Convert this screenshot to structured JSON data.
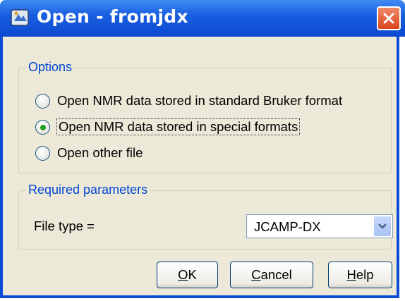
{
  "window": {
    "title": "Open - fromjdx",
    "close_icon": "close-icon",
    "app_icon": "application-icon"
  },
  "options": {
    "legend": "Options",
    "items": [
      {
        "label": "Open NMR data stored in standard Bruker format",
        "checked": false
      },
      {
        "label": "Open NMR data stored in special formats",
        "checked": true
      },
      {
        "label": "Open other file",
        "checked": false
      }
    ]
  },
  "params": {
    "legend": "Required parameters",
    "file_type_label": "File type =",
    "file_type_value": "JCAMP-DX"
  },
  "buttons": {
    "ok": {
      "mn": "O",
      "rest": "K"
    },
    "cancel": {
      "mn": "C",
      "rest": "ancel"
    },
    "help": {
      "mn": "H",
      "rest": "elp"
    }
  },
  "colors": {
    "title_bar": "#0b49d0",
    "legend_text": "#0046d5",
    "dialog_bg": "#ece9d8",
    "close_button": "#d9441c"
  }
}
